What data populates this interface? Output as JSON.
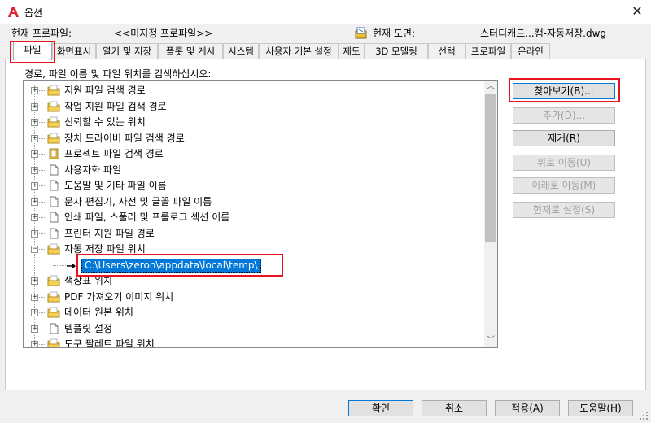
{
  "window": {
    "title": "옵션"
  },
  "profile": {
    "label": "현재 프로파일:",
    "value": "<<미지정 프로파일>>"
  },
  "drawing": {
    "label": "현재 도면:",
    "value": "스터디캐드...캠-자동저장.dwg"
  },
  "tabs": [
    {
      "label": "파일",
      "active": true
    },
    {
      "label": "화면표시"
    },
    {
      "label": "열기 및 저장"
    },
    {
      "label": "플롯 및 게시"
    },
    {
      "label": "시스템"
    },
    {
      "label": "사용자 기본 설정"
    },
    {
      "label": "제도"
    },
    {
      "label": "3D 모델링"
    },
    {
      "label": "선택"
    },
    {
      "label": "프로파일"
    },
    {
      "label": "온라인"
    }
  ],
  "tree_caption": "경로, 파일 이름 및 파일 위치를 검색하십시오:",
  "tree": {
    "items": [
      {
        "label": "지원 파일 검색 경로",
        "icon": "folder-icon"
      },
      {
        "label": "작업 지원 파일 검색 경로",
        "icon": "folder-icon"
      },
      {
        "label": "신뢰할 수 있는 위치",
        "icon": "folder-icon"
      },
      {
        "label": "장치 드라이버 파일 검색 경로",
        "icon": "folder-icon"
      },
      {
        "label": "프로젝트 파일 검색 경로",
        "icon": "project-file-icon"
      },
      {
        "label": "사용자화 파일",
        "icon": "file-icon"
      },
      {
        "label": "도움말 및 기타 파일 이름",
        "icon": "file-icon"
      },
      {
        "label": "문자 편집기, 사전 및 글꼴 파일 이름",
        "icon": "file-icon"
      },
      {
        "label": "인쇄 파일, 스풀러 및 프롤로그 섹션 이름",
        "icon": "file-icon"
      },
      {
        "label": "프린터 지원 파일 경로",
        "icon": "file-icon"
      },
      {
        "label": "자동 저장 파일 위치",
        "icon": "folder-icon",
        "expanded": true
      },
      {
        "label": "C:\\Users\\zeron\\appdata\\local\\temp\\",
        "child": true,
        "selected": true
      },
      {
        "label": "색상표 위치",
        "icon": "folder-icon"
      },
      {
        "label": "PDF 가져오기 이미지 위치",
        "icon": "folder-icon"
      },
      {
        "label": "데이터 원본 위치",
        "icon": "folder-icon"
      },
      {
        "label": "템플릿 설정",
        "icon": "file-icon"
      },
      {
        "label": "도구 팔레트 파일 위치",
        "icon": "folder-icon"
      }
    ]
  },
  "side_buttons": {
    "browse": "찾아보기(B)...",
    "add": "추가(D)...",
    "remove": "제거(R)",
    "move_up": "위로 이동(U)",
    "move_down": "아래로 이동(M)",
    "set_current": "현재로 설정(S)"
  },
  "bottom_buttons": {
    "ok": "확인",
    "cancel": "취소",
    "apply": "적용(A)",
    "help": "도움말(H)"
  },
  "colors": {
    "highlight_box": "#e8141f",
    "selection": "#0078d7",
    "folder": "#f0c040"
  }
}
